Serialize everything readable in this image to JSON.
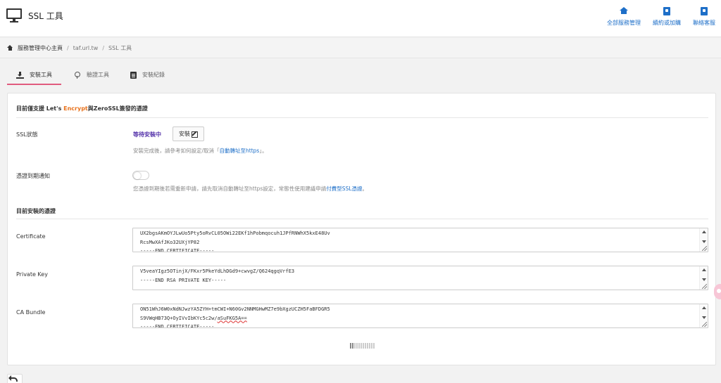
{
  "header": {
    "title": "SSL 工具",
    "nav": [
      {
        "label": "全部服務管理",
        "icon": "home-icon"
      },
      {
        "label": "續約或加購",
        "icon": "shopping-bag-icon"
      },
      {
        "label": "聯絡客服",
        "icon": "shopping-bag-icon"
      }
    ]
  },
  "breadcrumb": [
    "服務管理中心主頁",
    "taf.url.tw",
    "SSL 工具"
  ],
  "tabs": [
    {
      "label": "安裝工具",
      "icon": "download-icon",
      "active": true
    },
    {
      "label": "驗證工具",
      "icon": "map-pin-icon",
      "active": false
    },
    {
      "label": "安裝紀錄",
      "icon": "clipboard-icon",
      "active": false
    }
  ],
  "panel": {
    "notice_prefix": "目前僅支援 Let's ",
    "notice_highlight": "Encrypt",
    "notice_suffix": "與ZeroSSL簽發的憑證",
    "ssl_status_label": "SSL狀態",
    "ssl_status_value": "等待安裝中",
    "install_button": "安裝",
    "help1_prefix": "安裝完成後，請參考如何設定/取消「",
    "help1_link": "自動轉址至https",
    "help1_suffix": "」。",
    "expiry_label": "憑證到期通知",
    "expiry_enabled": false,
    "help2_prefix": "您憑證到期後若需重新申請，請先取消自動轉址至https設定，常態性使用建議申請",
    "help2_link": "付費型SSL憑證",
    "help2_suffix": "。",
    "installed_heading": "目前安裝的憑證",
    "certificate_label": "Certificate",
    "certificate_lines": [
      "UX2bgsAKmOYJLwUo5Pty5oRvCL05OWi22EKf1hPobmqocuh1JPfRNWhX5kxE48Uv",
      "RcsMwXAfJKo32UXjYP82",
      "-----END CERTIFICATE-----"
    ],
    "private_key_label": "Private Key",
    "private_key_lines": [
      "V5veaYIgz5OTinjX/FKxr5PkeYdLhDGd9+cwvgZ/Q624qgqVrfE3",
      "-----END RSA PRIVATE KEY-----"
    ],
    "ca_bundle_label": "CA Bundle",
    "ca_bundle_lines": [
      "ON51WhJ6W0xNdNJwzYA5ZYH+tmCWI+N60Gv2NNMGHwMZ7e9bXgzUCZH5FaBFDGR5",
      "S9VWqHB73Q+OyIVvIbKYc5c2w/",
      "-----END CERTIFICATE-----"
    ],
    "ca_bundle_line2_marked": "aSuFKG5A=="
  }
}
